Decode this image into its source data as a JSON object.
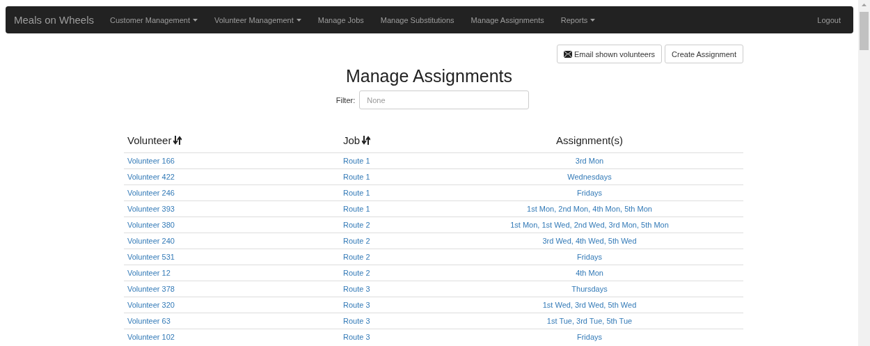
{
  "navbar": {
    "brand": "Meals on Wheels",
    "items": [
      {
        "label": "Customer Management",
        "dropdown": true
      },
      {
        "label": "Volunteer Management",
        "dropdown": true
      },
      {
        "label": "Manage Jobs",
        "dropdown": false
      },
      {
        "label": "Manage Substitutions",
        "dropdown": false
      },
      {
        "label": "Manage Assignments",
        "dropdown": false
      },
      {
        "label": "Reports",
        "dropdown": true
      }
    ],
    "logout": "Logout"
  },
  "actions": [
    "Email shown volunteers",
    "Create Assignment"
  ],
  "title": "Manage Assignments",
  "filter": {
    "label": "Filter:",
    "placeholder": "None"
  },
  "table": {
    "columns": [
      {
        "label": "Volunteer",
        "sortable": true
      },
      {
        "label": "Job",
        "sortable": true
      },
      {
        "label": "Assignment(s)",
        "sortable": false
      }
    ],
    "rows": [
      [
        "Volunteer 166",
        "Route 1",
        "3rd Mon"
      ],
      [
        "Volunteer 422",
        "Route 1",
        "Wednesdays"
      ],
      [
        "Volunteer 246",
        "Route 1",
        "Fridays"
      ],
      [
        "Volunteer 393",
        "Route 1",
        "1st Mon, 2nd Mon, 4th Mon, 5th Mon"
      ],
      [
        "Volunteer 380",
        "Route 2",
        "1st Mon, 1st Wed, 2nd Wed, 3rd Mon, 5th Mon"
      ],
      [
        "Volunteer 240",
        "Route 2",
        "3rd Wed, 4th Wed, 5th Wed"
      ],
      [
        "Volunteer 531",
        "Route 2",
        "Fridays"
      ],
      [
        "Volunteer 12",
        "Route 2",
        "4th Mon"
      ],
      [
        "Volunteer 378",
        "Route 3",
        "Thursdays"
      ],
      [
        "Volunteer 320",
        "Route 3",
        "1st Wed, 3rd Wed, 5th Wed"
      ],
      [
        "Volunteer 63",
        "Route 3",
        "1st Tue, 3rd Tue, 5th Tue"
      ],
      [
        "Volunteer 102",
        "Route 3",
        "Fridays"
      ]
    ]
  }
}
